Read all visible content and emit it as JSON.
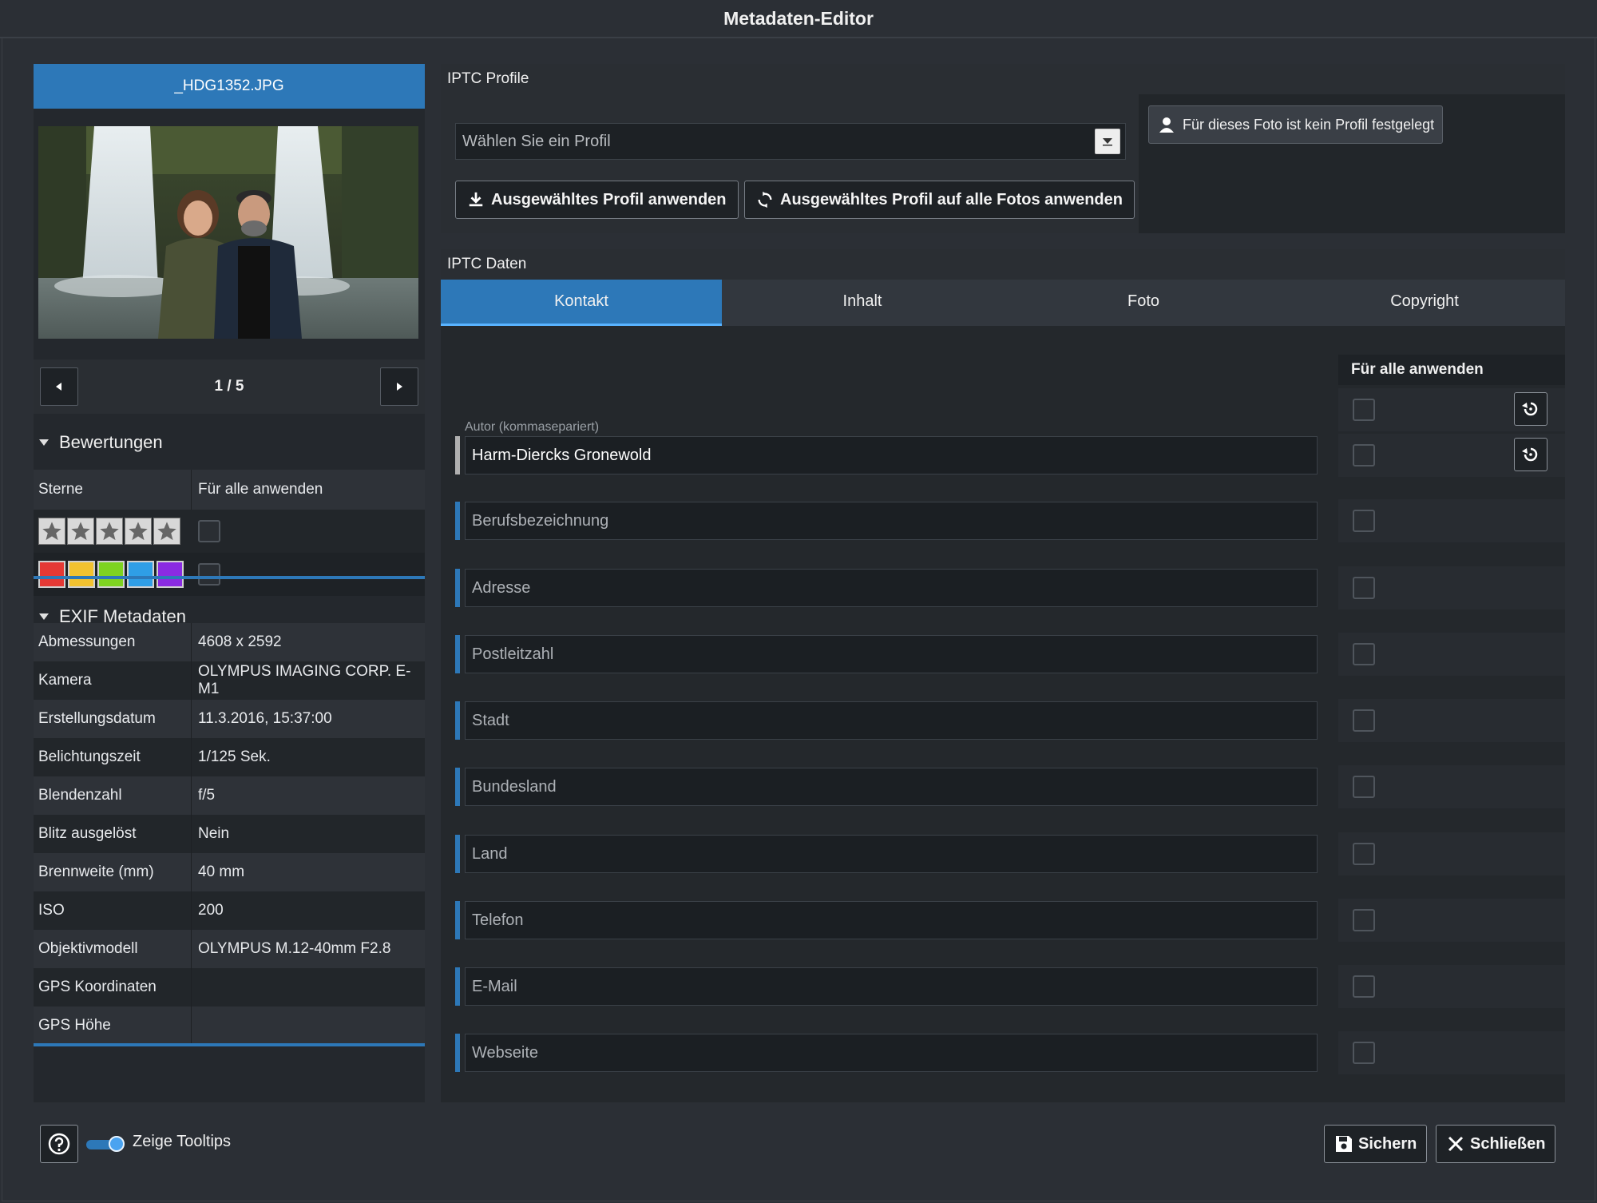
{
  "window": {
    "title": "Metadaten-Editor"
  },
  "preview": {
    "filename": "_HDG1352.JPG",
    "counter": "1 / 5",
    "image_alt": "Paar vor Wasserfall"
  },
  "ratings": {
    "title": "Bewertungen",
    "col_stars": "Sterne",
    "col_apply_all": "Für alle anwenden",
    "star_count": 5,
    "stars_filled": 0,
    "color_labels": [
      "#e53935",
      "#f2c230",
      "#7ed321",
      "#2f9ee6",
      "#8a2be2"
    ]
  },
  "exif": {
    "title": "EXIF Metadaten",
    "rows": [
      {
        "key": "Abmessungen",
        "value": "4608 x 2592"
      },
      {
        "key": "Kamera",
        "value": "OLYMPUS IMAGING CORP. E-M1"
      },
      {
        "key": "Erstellungsdatum",
        "value": "11.3.2016, 15:37:00"
      },
      {
        "key": "Belichtungszeit",
        "value": "1/125 Sek."
      },
      {
        "key": "Blendenzahl",
        "value": "f/5"
      },
      {
        "key": "Blitz ausgelöst",
        "value": "Nein"
      },
      {
        "key": "Brennweite (mm)",
        "value": "40 mm"
      },
      {
        "key": "ISO",
        "value": "200"
      },
      {
        "key": "Objektivmodell",
        "value": "OLYMPUS M.12-40mm F2.8"
      },
      {
        "key": "GPS Koordinaten",
        "value": ""
      },
      {
        "key": "GPS Höhe",
        "value": ""
      }
    ]
  },
  "iptc_profile": {
    "title": "IPTC Profile",
    "select_placeholder": "Wählen Sie ein Profil",
    "apply_button": "Ausgewähltes Profil anwenden",
    "apply_all_button": "Ausgewähltes Profil auf alle Fotos anwenden",
    "no_profile_button": "Für dieses Foto ist kein Profil festgelegt"
  },
  "iptc_data": {
    "title": "IPTC Daten",
    "tabs": [
      "Kontakt",
      "Inhalt",
      "Foto",
      "Copyright"
    ],
    "active_tab": "Kontakt",
    "apply_all_header": "Für alle anwenden",
    "author_label": "Autor (kommasepariert)",
    "fields": [
      {
        "value": "Harm-Diercks Gronewold"
      },
      {
        "placeholder": "Berufsbezeichnung"
      },
      {
        "placeholder": "Adresse"
      },
      {
        "placeholder": "Postleitzahl"
      },
      {
        "placeholder": "Stadt"
      },
      {
        "placeholder": "Bundesland"
      },
      {
        "placeholder": "Land"
      },
      {
        "placeholder": "Telefon"
      },
      {
        "placeholder": "E-Mail"
      },
      {
        "placeholder": "Webseite"
      }
    ]
  },
  "footer": {
    "tooltips_label": "Zeige Tooltips",
    "tooltips_on": true,
    "save_button": "Sichern",
    "close_button": "Schließen"
  },
  "colors": {
    "accent": "#2d78b8",
    "background": "#2b2f35"
  }
}
